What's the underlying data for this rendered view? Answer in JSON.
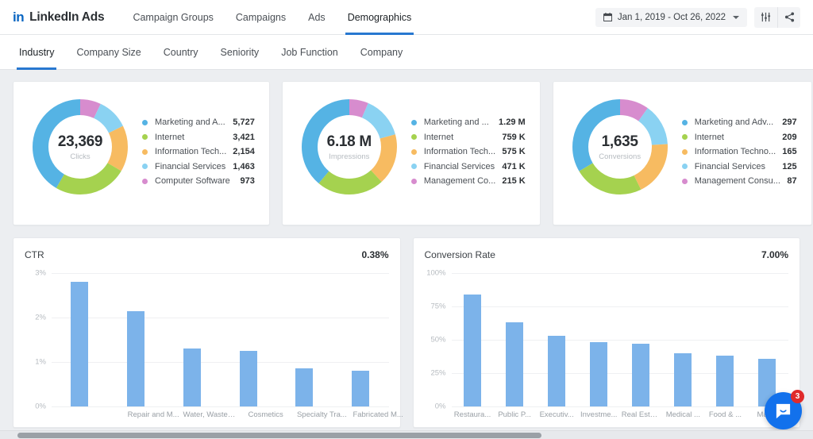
{
  "header": {
    "logo_text": "in",
    "brand": "LinkedIn Ads",
    "nav": [
      {
        "label": "Campaign Groups",
        "active": false
      },
      {
        "label": "Campaigns",
        "active": false
      },
      {
        "label": "Ads",
        "active": false
      },
      {
        "label": "Demographics",
        "active": true
      }
    ],
    "date_range": "Jan 1, 2019 - Oct 26, 2022",
    "filter_icon": "sliders-icon",
    "share_icon": "share-icon",
    "calendar_icon": "calendar-icon"
  },
  "subtabs": [
    {
      "label": "Industry",
      "active": true
    },
    {
      "label": "Company Size",
      "active": false
    },
    {
      "label": "Country",
      "active": false
    },
    {
      "label": "Seniority",
      "active": false
    },
    {
      "label": "Job Function",
      "active": false
    },
    {
      "label": "Company",
      "active": false
    }
  ],
  "colors": {
    "blue": "#55b3e4",
    "green": "#a5d24f",
    "orange": "#f7bb61",
    "lightblue": "#8ad2f2",
    "pink": "#d78cce",
    "bar": "#7cb3ea",
    "accent": "#2878d0",
    "brand": "#0a66c2"
  },
  "chart_data": [
    {
      "type": "pie",
      "title": "Clicks",
      "center_value": "23,369",
      "center_label": "Clicks",
      "categories": [
        "Marketing and A...",
        "Internet",
        "Information Tech...",
        "Financial Services",
        "Computer Software"
      ],
      "values": [
        5727,
        3421,
        2154,
        1463,
        973
      ],
      "value_labels": [
        "5,727",
        "3,421",
        "2,154",
        "1,463",
        "973"
      ],
      "colors": [
        "#55b3e4",
        "#a5d24f",
        "#f7bb61",
        "#8ad2f2",
        "#d78cce"
      ],
      "legend": "right"
    },
    {
      "type": "pie",
      "title": "Impressions",
      "center_value": "6.18 M",
      "center_label": "Impressions",
      "categories": [
        "Marketing and ...",
        "Internet",
        "Information Tech...",
        "Financial Services",
        "Management Co..."
      ],
      "values": [
        1290000,
        759000,
        575000,
        471000,
        215000
      ],
      "value_labels": [
        "1.29 M",
        "759 K",
        "575 K",
        "471 K",
        "215 K"
      ],
      "colors": [
        "#55b3e4",
        "#a5d24f",
        "#f7bb61",
        "#8ad2f2",
        "#d78cce"
      ],
      "legend": "right"
    },
    {
      "type": "pie",
      "title": "Conversions",
      "center_value": "1,635",
      "center_label": "Conversions",
      "categories": [
        "Marketing and Adv...",
        "Internet",
        "Information Techno...",
        "Financial Services",
        "Management Consu..."
      ],
      "values": [
        297,
        209,
        165,
        125,
        87
      ],
      "value_labels": [
        "297",
        "209",
        "165",
        "125",
        "87"
      ],
      "colors": [
        "#55b3e4",
        "#a5d24f",
        "#f7bb61",
        "#8ad2f2",
        "#d78cce"
      ],
      "legend": "right"
    },
    {
      "type": "bar",
      "title": "CTR",
      "kpi": "0.38%",
      "categories": [
        "Repair and M...",
        "Water, Waste,...",
        "Cosmetics",
        "Specialty Tra...",
        "Fabricated M..."
      ],
      "values": [
        2.8,
        2.15,
        1.3,
        1.25,
        0.85,
        0.8
      ],
      "ylim": [
        0,
        3
      ],
      "yticks": [
        "3%",
        "2%",
        "1%",
        "0%"
      ],
      "ylabel": "",
      "xlabel": "",
      "grid": true
    },
    {
      "type": "bar",
      "title": "Conversion Rate",
      "kpi": "7.00%",
      "categories": [
        "Restaura...",
        "Public P...",
        "Executiv...",
        "Investme...",
        "Real Estate",
        "Medical ...",
        "Food & ...",
        "Mac..."
      ],
      "values": [
        84,
        63,
        53,
        48,
        47,
        40,
        38,
        36
      ],
      "ylim": [
        0,
        100
      ],
      "yticks": [
        "100%",
        "75%",
        "50%",
        "25%",
        "0%"
      ],
      "ylabel": "",
      "xlabel": "",
      "grid": true
    }
  ],
  "chat": {
    "badge": "3",
    "icon": "chat-bubble-icon"
  }
}
